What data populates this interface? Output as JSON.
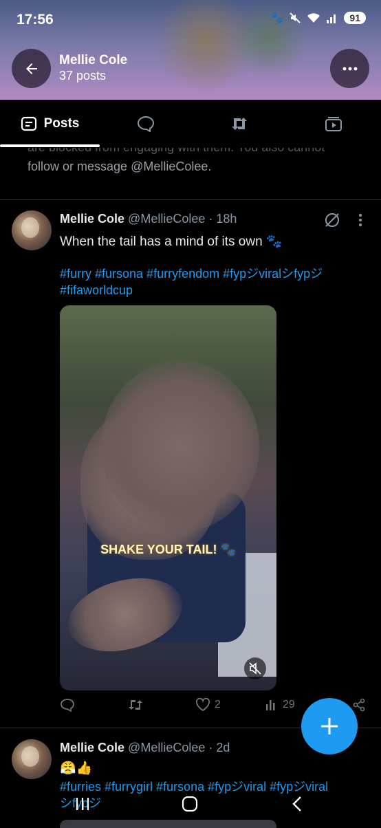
{
  "status_bar": {
    "time": "17:56",
    "battery": "91"
  },
  "header": {
    "name": "Mellie Cole",
    "posts_count": "37 posts"
  },
  "tabs": {
    "posts_label": "Posts"
  },
  "blocked_notice": {
    "line1": "are blocked from engaging with them. You also cannot",
    "line2": "follow or message @MellieColee."
  },
  "posts": [
    {
      "name": "Mellie Cole",
      "handle": "@MellieColee · 18h",
      "text": "When the tail has a mind of its own 🐾",
      "hashtags_line1": "#furry #fursona #furryfendom #fypジviralシfypジ",
      "hashtags_line2": "#fifaworldcup",
      "video_caption": "SHAKE YOUR TAIL! 🐾",
      "likes": "2",
      "views": "29"
    },
    {
      "name": "Mellie Cole",
      "handle": "@MellieColee · 2d",
      "text": "😤👍",
      "hashtags_line1": "#furries #furrygirl #fursona #fypジviral #fypジviral",
      "hashtags_line2": "シfypジ"
    }
  ],
  "colors": {
    "accent": "#1d9bf0",
    "background": "#000000",
    "muted": "#71767b"
  },
  "icons": [
    "back-arrow-icon",
    "more-icon",
    "posts-icon",
    "replies-icon",
    "reposts-icon",
    "media-icon",
    "grok-icon",
    "reply-icon",
    "repost-icon",
    "like-icon",
    "views-icon",
    "share-icon",
    "mute-icon",
    "plus-icon"
  ]
}
